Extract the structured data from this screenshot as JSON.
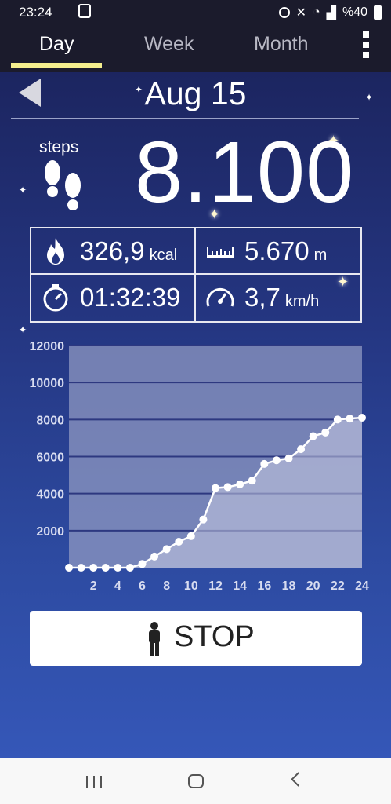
{
  "status_bar": {
    "time": "23:24",
    "battery": "%40"
  },
  "tabs": [
    {
      "label": "Day",
      "active": true
    },
    {
      "label": "Week",
      "active": false
    },
    {
      "label": "Month",
      "active": false
    }
  ],
  "header": {
    "date": "Aug 15"
  },
  "steps": {
    "label": "steps",
    "value": "8.100"
  },
  "stats": {
    "calories": {
      "value": "326,9",
      "unit": "kcal"
    },
    "distance": {
      "value": "5.670",
      "unit": "m"
    },
    "duration": {
      "value": "01:32:39"
    },
    "speed": {
      "value": "3,7",
      "unit": "km/h"
    }
  },
  "colors": {
    "accent": "#f4ee8e",
    "chart_fill": "#8f98c2",
    "bg_top": "#1c2560",
    "bg_bottom": "#3557b8"
  },
  "chart_data": {
    "type": "area",
    "xlabel": "",
    "ylabel": "",
    "ylim": [
      0,
      12000
    ],
    "xlim": [
      0,
      24
    ],
    "y_ticks": [
      2000,
      4000,
      6000,
      8000,
      10000,
      12000
    ],
    "x_ticks": [
      2,
      4,
      6,
      8,
      10,
      12,
      14,
      16,
      18,
      20,
      22,
      24
    ],
    "grid": true,
    "series": [
      {
        "x": [
          0,
          1,
          2,
          3,
          4,
          5,
          6,
          7,
          8,
          9,
          10,
          11,
          12,
          13,
          14,
          15,
          16,
          17,
          18,
          19,
          20,
          21,
          22,
          23,
          24
        ],
        "values": [
          0,
          0,
          0,
          0,
          0,
          0,
          200,
          600,
          1000,
          1400,
          1700,
          2600,
          4300,
          4350,
          4500,
          4700,
          5600,
          5800,
          5900,
          6400,
          7100,
          7300,
          8000,
          8050,
          8100
        ]
      }
    ]
  },
  "stop_button": {
    "label": "STOP"
  }
}
